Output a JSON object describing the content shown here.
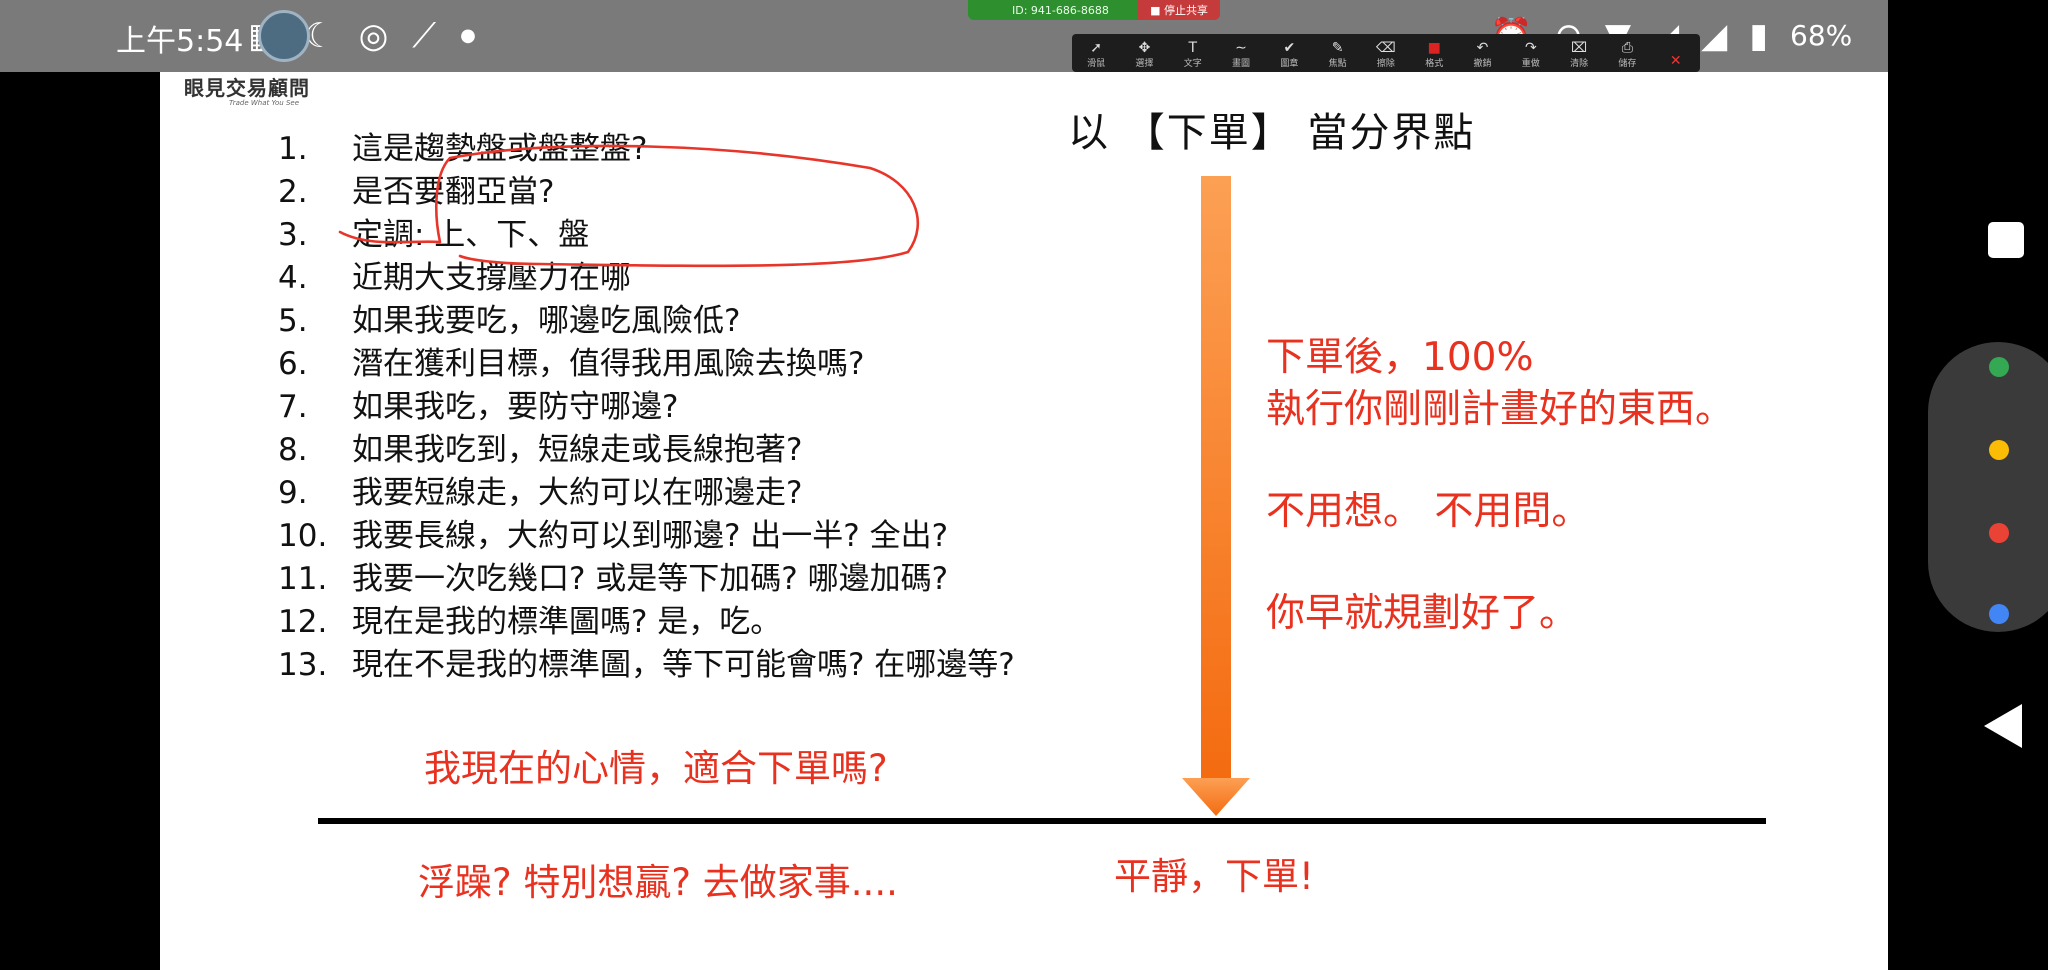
{
  "status_bar": {
    "time": "上午5:54",
    "left_icons": [
      "grid-icon",
      "moon-icon",
      "sync-icon",
      "chart-icon",
      "dot-icon"
    ],
    "right_icons": [
      "alarm-icon",
      "dnd-icon",
      "wifi-icon",
      "signal-icon",
      "signal-icon",
      "battery-icon"
    ],
    "battery": "68%"
  },
  "zoom_share": {
    "meeting_id": "ID: 941-686-8688",
    "stop_share": "■ 停止共享"
  },
  "annotation_toolbar": {
    "tools": [
      {
        "glyph": "➚",
        "label": "滑鼠"
      },
      {
        "glyph": "✥",
        "label": "選擇"
      },
      {
        "glyph": "T",
        "label": "文字"
      },
      {
        "glyph": "∼",
        "label": "畫圖"
      },
      {
        "glyph": "✔",
        "label": "圖章"
      },
      {
        "glyph": "✎",
        "label": "焦點"
      },
      {
        "glyph": "⌫",
        "label": "擦除"
      },
      {
        "glyph": "■",
        "label": "格式"
      },
      {
        "glyph": "↶",
        "label": "撤銷"
      },
      {
        "glyph": "↷",
        "label": "重做"
      },
      {
        "glyph": "⌧",
        "label": "清除"
      },
      {
        "glyph": "⎙",
        "label": "儲存"
      },
      {
        "glyph": "✕",
        "label": ""
      }
    ]
  },
  "slide": {
    "logo": {
      "title": "眼見交易顧問",
      "subtitle": "Trade What You See"
    },
    "pivot_title": "以 【下單】 當分界點",
    "questions": [
      {
        "num": "1.",
        "text": "這是趨勢盤或盤整盤?"
      },
      {
        "num": "2.",
        "text": "是否要翻亞當?"
      },
      {
        "num": "3.",
        "text": "定調: 上、下、盤"
      },
      {
        "num": "4.",
        "text": "近期大支撐壓力在哪"
      },
      {
        "num": "5.",
        "text": "如果我要吃，哪邊吃風險低?"
      },
      {
        "num": "6.",
        "text": "潛在獲利目標，值得我用風險去換嗎?"
      },
      {
        "num": "7.",
        "text": "如果我吃，要防守哪邊?"
      },
      {
        "num": "8.",
        "text": "如果我吃到，短線走或長線抱著?"
      },
      {
        "num": "9.",
        "text": "我要短線走，大約可以在哪邊走?"
      },
      {
        "num": "10.",
        "text": "我要長線，大約可以到哪邊? 出一半? 全出?"
      },
      {
        "num": "11.",
        "text": "我要一次吃幾口? 或是等下加碼? 哪邊加碼?"
      },
      {
        "num": "12.",
        "text": "現在是我的標準圖嗎?  是，吃。"
      },
      {
        "num": "13.",
        "text": "現在不是我的標準圖，等下可能會嗎? 在哪邊等?"
      }
    ],
    "after_order": {
      "line1": "下單後，100%",
      "line2": "執行你剛剛計畫好的東西。",
      "line3": "不用想。 不用問。",
      "line4": "你早就規劃好了。"
    },
    "mood_question": "我現在的心情，適合下單嗎?",
    "impatient": "浮躁? 特別想贏? 去做家事....",
    "calm": "平靜，下單!",
    "colors": {
      "accent_red": "#e8311f",
      "arrow_top": "#fca054",
      "arrow_bottom": "#f46b10",
      "annotation": "#e8352a"
    }
  },
  "nav_bar": {
    "buttons": [
      "recents-square-icon",
      "back-triangle-icon"
    ],
    "dot_colors": [
      "#34a853",
      "#fbbc05",
      "#ea4335",
      "#4285f4"
    ]
  }
}
